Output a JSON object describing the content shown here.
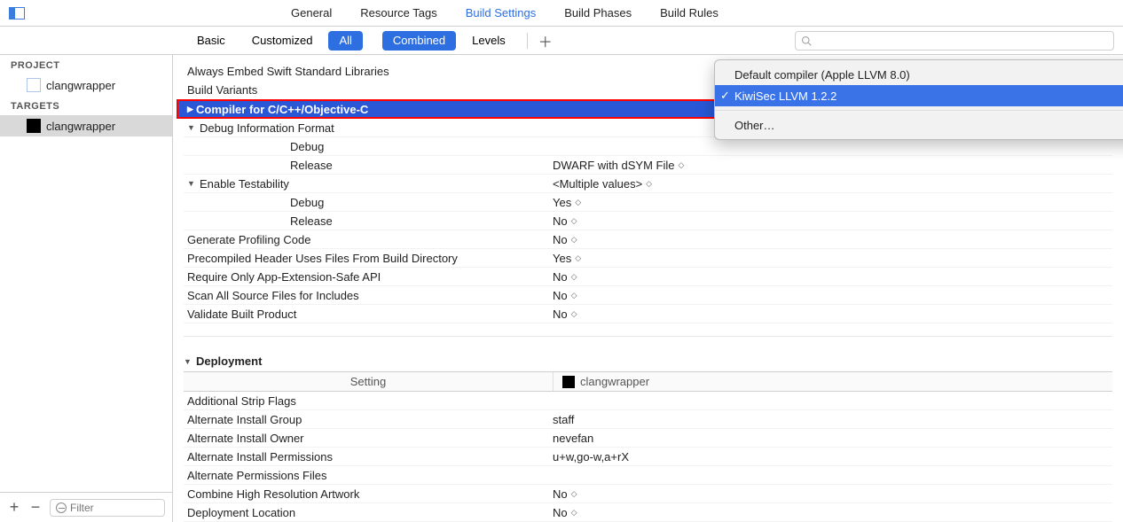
{
  "top_tabs": {
    "general": "General",
    "resource_tags": "Resource Tags",
    "build_settings": "Build Settings",
    "build_phases": "Build Phases",
    "build_rules": "Build Rules"
  },
  "filter_tabs": {
    "basic": "Basic",
    "customized": "Customized",
    "all": "All",
    "combined": "Combined",
    "levels": "Levels"
  },
  "search": {
    "placeholder": ""
  },
  "sidebar": {
    "project_header": "PROJECT",
    "targets_header": "TARGETS",
    "project_item": "clangwrapper",
    "target_item": "clangwrapper",
    "filter_placeholder": "Filter"
  },
  "settings": {
    "always_embed": "Always Embed Swift Standard Libraries",
    "build_variants": "Build Variants",
    "compiler": "Compiler for C/C++/Objective-C",
    "debug_info_format": {
      "label": "Debug Information Format",
      "debug": "Debug",
      "release": "Release",
      "release_val": "DWARF with dSYM File"
    },
    "enable_testability": {
      "label": "Enable Testability",
      "value": "<Multiple values>",
      "debug": "Debug",
      "debug_val": "Yes",
      "release": "Release",
      "release_val": "No"
    },
    "generate_profiling": {
      "label": "Generate Profiling Code",
      "value": "No"
    },
    "precompiled_header": {
      "label": "Precompiled Header Uses Files From Build Directory",
      "value": "Yes"
    },
    "require_app_ext": {
      "label": "Require Only App-Extension-Safe API",
      "value": "No"
    },
    "scan_all_source": {
      "label": "Scan All Source Files for Includes",
      "value": "No"
    },
    "validate_built": {
      "label": "Validate Built Product",
      "value": "No"
    }
  },
  "deployment": {
    "title": "Deployment",
    "col_setting": "Setting",
    "col_target": "clangwrapper",
    "additional_strip": "Additional Strip Flags",
    "alt_install_group": {
      "label": "Alternate Install Group",
      "value": "staff"
    },
    "alt_install_owner": {
      "label": "Alternate Install Owner",
      "value": "nevefan"
    },
    "alt_install_perms": {
      "label": "Alternate Install Permissions",
      "value": "u+w,go-w,a+rX"
    },
    "alt_perms_files": "Alternate Permissions Files",
    "combine_high_res": {
      "label": "Combine High Resolution Artwork",
      "value": "No"
    },
    "deployment_location": {
      "label": "Deployment Location",
      "value": "No"
    }
  },
  "dropdown": {
    "default": "Default compiler (Apple LLVM 8.0)",
    "kiwisec": "KiwiSec LLVM 1.2.2",
    "other": "Other…"
  }
}
